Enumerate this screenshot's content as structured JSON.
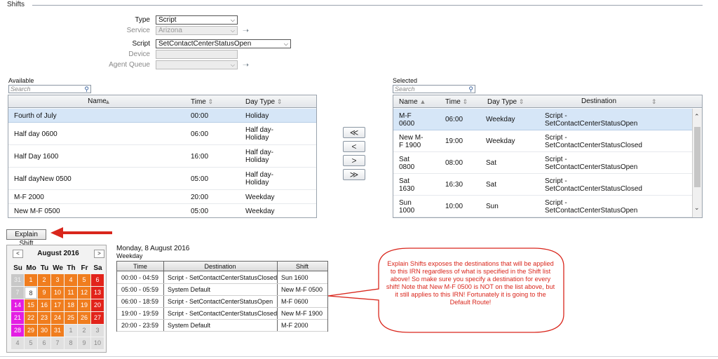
{
  "section_title": "Shifts",
  "form": {
    "type_label": "Type",
    "type_value": "Script",
    "service_label": "Service",
    "service_value": "Arizona",
    "script_label": "Script",
    "script_value": "SetContactCenterStatusOpen",
    "device_label": "Device",
    "agent_queue_label": "Agent Queue"
  },
  "available": {
    "label": "Available",
    "search_placeholder": "Search",
    "columns": [
      "Name",
      "Time",
      "Day Type"
    ],
    "rows": [
      {
        "name": "Fourth of July",
        "time": "00:00",
        "day_type": "Holiday",
        "selected": true
      },
      {
        "name": "Half day 0600",
        "time": "06:00",
        "day_type": "Half day-\nHoliday"
      },
      {
        "name": "Half Day 1600",
        "time": "16:00",
        "day_type": "Half day-\nHoliday"
      },
      {
        "name": "Half dayNew 0500",
        "time": "05:00",
        "day_type": "Half day-\nHoliday"
      },
      {
        "name": "M-F 2000",
        "time": "20:00",
        "day_type": "Weekday"
      },
      {
        "name": "New M-F 0500",
        "time": "05:00",
        "day_type": "Weekday"
      }
    ]
  },
  "move_buttons": [
    "≪",
    "<",
    ">",
    "≫"
  ],
  "selected": {
    "label": "Selected",
    "search_placeholder": "Search",
    "columns": [
      "Name",
      "Time",
      "Day Type",
      "Destination"
    ],
    "rows": [
      {
        "name": "M-F\n0600",
        "time": "06:00",
        "day_type": "Weekday",
        "destination": "Script -\nSetContactCenterStatusOpen",
        "selected": true
      },
      {
        "name": "New M-\nF 1900",
        "time": "19:00",
        "day_type": "Weekday",
        "destination": "Script -\nSetContactCenterStatusClosed"
      },
      {
        "name": "Sat\n0800",
        "time": "08:00",
        "day_type": "Sat",
        "destination": "Script -\nSetContactCenterStatusOpen"
      },
      {
        "name": "Sat\n1630",
        "time": "16:30",
        "day_type": "Sat",
        "destination": "Script -\nSetContactCenterStatusClosed"
      },
      {
        "name": "Sun\n1000",
        "time": "10:00",
        "day_type": "Sun",
        "destination": "Script -\nSetContactCenterStatusOpen"
      }
    ]
  },
  "explain_button": "Explain Shift",
  "calendar": {
    "month_label": "August 2016",
    "prev": "<",
    "next": ">",
    "days_of_week": [
      "Su",
      "Mo",
      "Tu",
      "We",
      "Th",
      "Fr",
      "Sa"
    ],
    "weeks": [
      [
        [
          "31",
          "gray"
        ],
        [
          "1",
          "orange"
        ],
        [
          "2",
          "orange"
        ],
        [
          "3",
          "orange"
        ],
        [
          "4",
          "orange"
        ],
        [
          "5",
          "orange"
        ],
        [
          "6",
          "red"
        ]
      ],
      [
        [
          "7",
          "gray"
        ],
        [
          "8",
          "white"
        ],
        [
          "9",
          "orange"
        ],
        [
          "10",
          "orange"
        ],
        [
          "11",
          "orange"
        ],
        [
          "12",
          "orange"
        ],
        [
          "13",
          "red"
        ]
      ],
      [
        [
          "14",
          "mag"
        ],
        [
          "15",
          "orange"
        ],
        [
          "16",
          "orange"
        ],
        [
          "17",
          "orange"
        ],
        [
          "18",
          "orange"
        ],
        [
          "19",
          "orange"
        ],
        [
          "20",
          "red"
        ]
      ],
      [
        [
          "21",
          "mag"
        ],
        [
          "22",
          "orange"
        ],
        [
          "23",
          "orange"
        ],
        [
          "24",
          "orange"
        ],
        [
          "25",
          "orange"
        ],
        [
          "26",
          "orange"
        ],
        [
          "27",
          "red"
        ]
      ],
      [
        [
          "28",
          "mag"
        ],
        [
          "29",
          "orange"
        ],
        [
          "30",
          "orange"
        ],
        [
          "31",
          "orange"
        ],
        [
          "1",
          "blank"
        ],
        [
          "2",
          "blank"
        ],
        [
          "3",
          "blank"
        ]
      ],
      [
        [
          "4",
          "blank"
        ],
        [
          "5",
          "blank"
        ],
        [
          "6",
          "blank"
        ],
        [
          "7",
          "blank"
        ],
        [
          "8",
          "blank"
        ],
        [
          "9",
          "blank"
        ],
        [
          "10",
          "blank"
        ]
      ]
    ]
  },
  "explain": {
    "date_label": "Monday, 8 August 2016",
    "day_type": "Weekday",
    "columns": [
      "Time",
      "Destination",
      "Shift"
    ],
    "rows": [
      {
        "time": "00:00 - 04:59",
        "destination": "Script - SetContactCenterStatusClosed",
        "shift": "Sun 1600"
      },
      {
        "time": "05:00 - 05:59",
        "destination": "System Default",
        "shift": "New M-F 0500"
      },
      {
        "time": "06:00 - 18:59",
        "destination": "Script - SetContactCenterStatusOpen",
        "shift": "M-F 0600"
      },
      {
        "time": "19:00 - 19:59",
        "destination": "Script - SetContactCenterStatusClosed",
        "shift": "New M-F 1900"
      },
      {
        "time": "20:00 - 23:59",
        "destination": "System Default",
        "shift": "M-F 2000"
      }
    ]
  },
  "callout": {
    "text": "Explain Shifts exposes the destinations that will be applied to this IRN regardless of what is specified in the Shift list above!   So make sure you specify a destination for every shift!  Note that New M-F 0500 is NOT on the list above, but it still applies to this IRN! Fortunately it is going to the Default Route!"
  },
  "colors": {
    "accent_red": "#d9261c",
    "selected_row": "#d6e6f7",
    "cal_orange": "#f07d1e",
    "cal_red": "#e2231a",
    "cal_magenta": "#e31ee3"
  }
}
